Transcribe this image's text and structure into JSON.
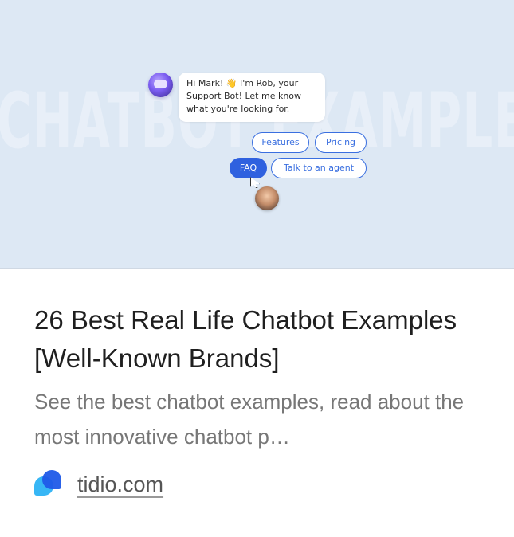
{
  "hero": {
    "watermark": "CHATBOT EXAMPLES",
    "bot_message": "Hi Mark! 👋 I'm Rob, your Support Bot! Let me know what you're looking for.",
    "chips": [
      "Features",
      "Pricing",
      "FAQ",
      "Talk to an agent"
    ],
    "active_chip": "FAQ"
  },
  "article": {
    "title": "26 Best Real Life Chatbot Examples [Well-Known Brands]",
    "description": "See the best chatbot examples, read about the most innovative chatbot p…"
  },
  "source": {
    "domain": "tidio.com",
    "logo_icon": "tidio-logo-icon"
  },
  "colors": {
    "hero_background": "#dde8f4",
    "chip_accent": "#2f61df",
    "title_text": "#1f1f1f",
    "description_text": "#777777"
  }
}
